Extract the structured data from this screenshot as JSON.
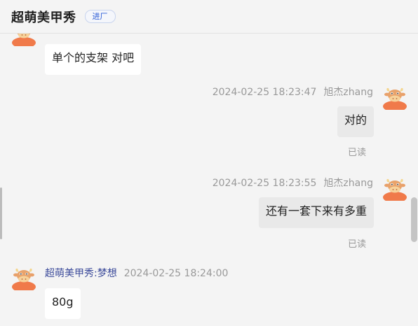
{
  "header": {
    "title": "超萌美甲秀",
    "badge": "进厂"
  },
  "messages": [
    {
      "direction": "in",
      "text": "单个的支架 对吧"
    },
    {
      "direction": "out",
      "time": "2024-02-25 18:23:47",
      "sender": "旭杰zhang",
      "text": "对的",
      "status": "已读"
    },
    {
      "direction": "out",
      "time": "2024-02-25 18:23:55",
      "sender": "旭杰zhang",
      "text": "还有一套下来有多重",
      "status": "已读"
    },
    {
      "direction": "in",
      "time": "2024-02-25 18:24:00",
      "sender": "超萌美甲秀:梦想",
      "text": "80g"
    }
  ],
  "colors": {
    "accent": "#2a5bd7",
    "sender_name": "#3b4a9a",
    "avatar": "#f07a4a"
  },
  "icons": {
    "avatar": "cow-mascot-avatar-icon"
  }
}
